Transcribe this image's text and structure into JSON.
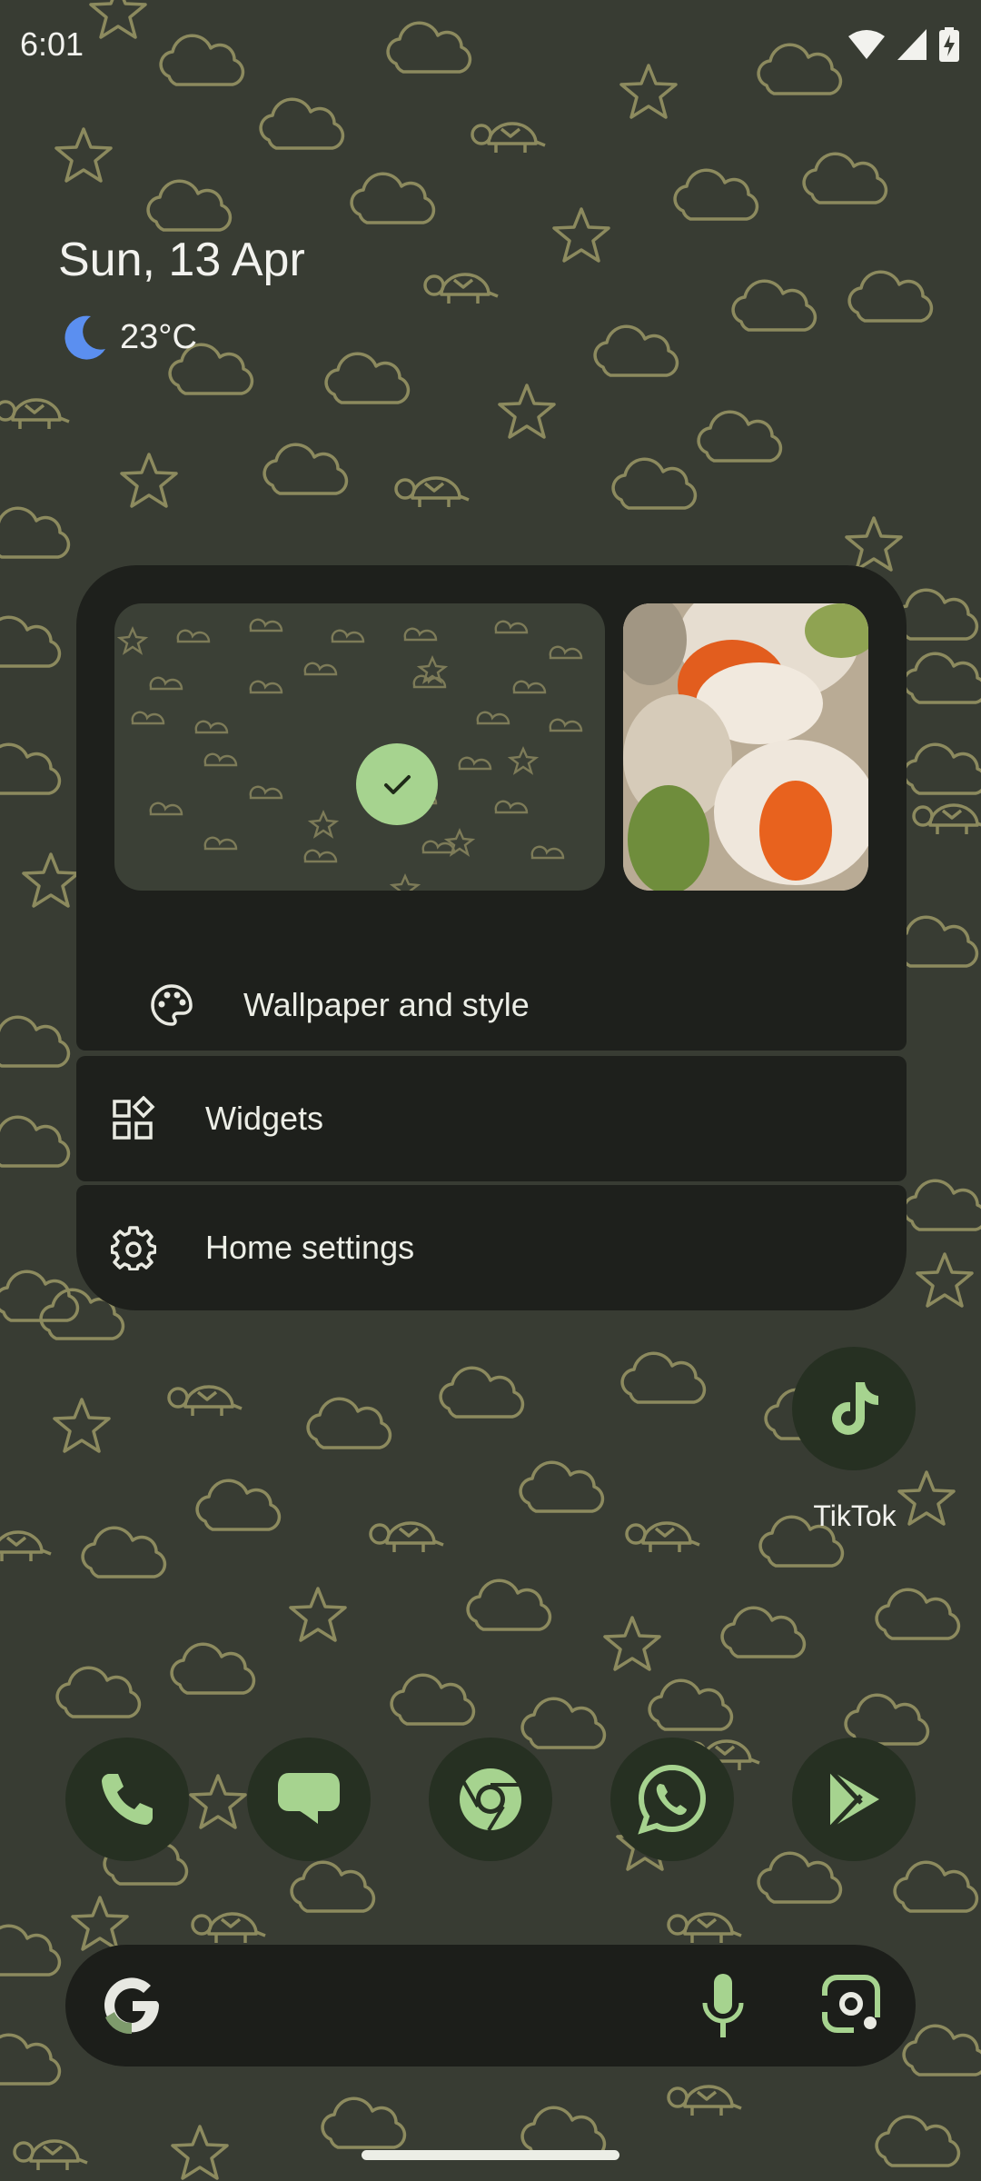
{
  "status_bar": {
    "time": "6:01",
    "icons": [
      "wifi-icon",
      "cell-signal-icon",
      "battery-charging-icon"
    ]
  },
  "glance": {
    "date": "Sun, 13 Apr",
    "weather_icon": "moon-icon",
    "temperature": "23°C"
  },
  "popup": {
    "wallpapers": [
      {
        "name": "current-wallpaper-thumb",
        "selected": true
      },
      {
        "name": "alternate-wallpaper-thumb",
        "selected": false
      }
    ],
    "items": [
      {
        "label": "Wallpaper and style",
        "icon": "palette-icon"
      },
      {
        "label": "Widgets",
        "icon": "widgets-icon"
      },
      {
        "label": "Home settings",
        "icon": "gear-icon"
      }
    ]
  },
  "apps": {
    "tiktok_label": "TikTok"
  },
  "dock": [
    "phone-icon",
    "messages-icon",
    "chrome-icon",
    "whatsapp-icon",
    "play-store-icon"
  ],
  "search": {
    "icons": [
      "google-g-icon",
      "microphone-icon",
      "google-lens-icon"
    ]
  },
  "colors": {
    "accent": "#a6d38f",
    "surface": "#1e201c",
    "background": "#383c33",
    "pattern": "#8a8a5e"
  }
}
